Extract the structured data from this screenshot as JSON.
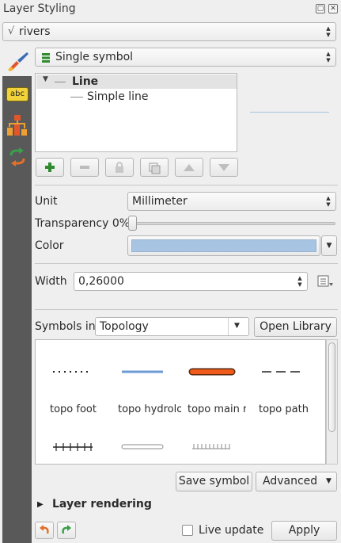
{
  "window": {
    "title": "Layer Styling"
  },
  "layer_select": {
    "value": "rivers"
  },
  "renderer_select": {
    "value": "Single symbol"
  },
  "symbol_tree": {
    "root": "Line",
    "child": "Simple line"
  },
  "unit": {
    "label": "Unit",
    "value": "Millimeter"
  },
  "transparency": {
    "label": "Transparency 0%",
    "value": 0
  },
  "color": {
    "label": "Color",
    "value": "#a7c4e2"
  },
  "width": {
    "label": "Width",
    "value": "0,26000"
  },
  "symbols_in": {
    "label": "Symbols in",
    "value": "Topology",
    "open_library": "Open Library"
  },
  "library_items": [
    {
      "name": "topo foot"
    },
    {
      "name": "topo hydrology"
    },
    {
      "name": "topo main road"
    },
    {
      "name": "topo path"
    }
  ],
  "buttons": {
    "save_symbol": "Save symbol",
    "advanced": "Advanced"
  },
  "layer_rendering": {
    "label": "Layer rendering"
  },
  "footer": {
    "live_update": "Live update",
    "apply": "Apply"
  },
  "sidebar_icons": [
    "paintbrush-icon",
    "label-abc-icon",
    "diagram-icon",
    "history-icon"
  ]
}
